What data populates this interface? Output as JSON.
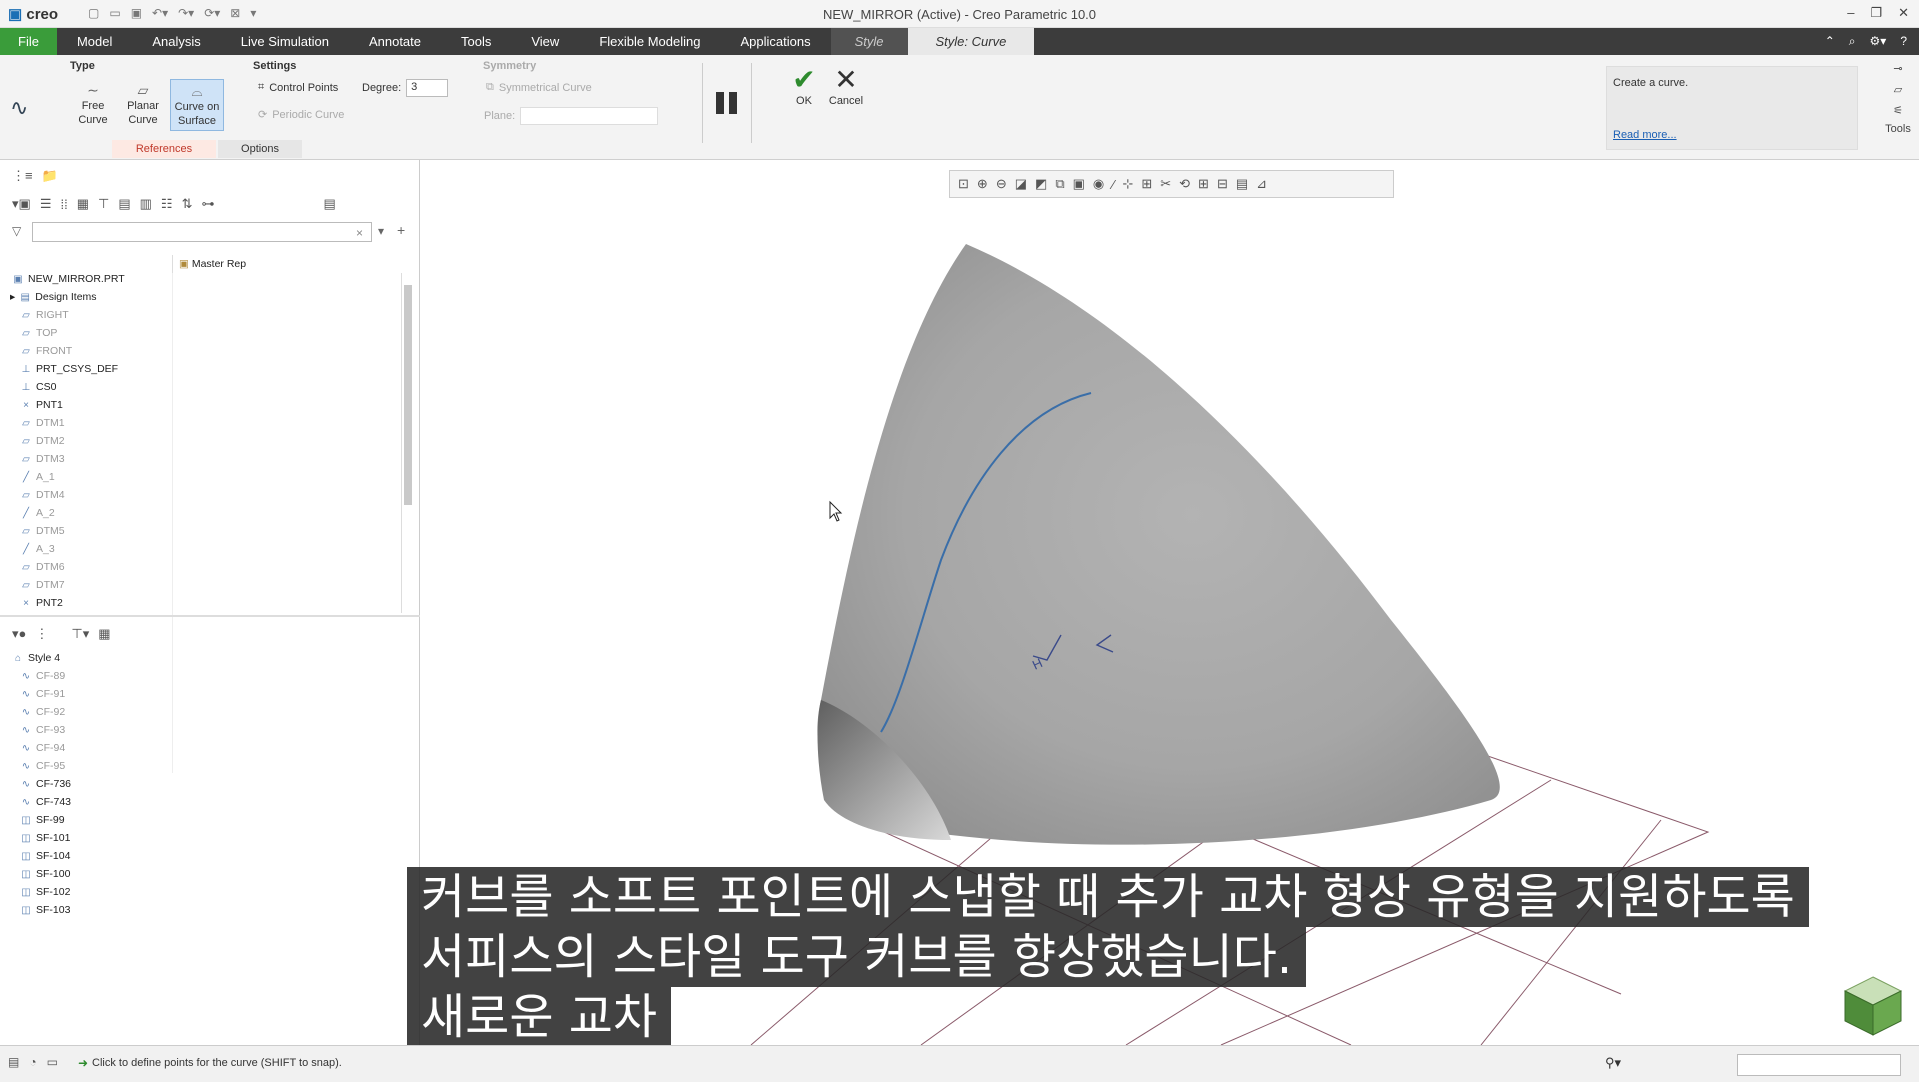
{
  "titlebar": {
    "logo": "creo",
    "title": "NEW_MIRROR (Active) - Creo Parametric 10.0",
    "window_controls": [
      "–",
      "❐",
      "✕"
    ]
  },
  "menu": {
    "file": "File",
    "items": [
      "Model",
      "Analysis",
      "Live Simulation",
      "Annotate",
      "Tools",
      "View",
      "Flexible Modeling",
      "Applications"
    ],
    "style": "Style",
    "style_curve": "Style: Curve"
  },
  "ribbon": {
    "type_label": "Type",
    "free_curve": "Free Curve",
    "planar_curve": "Planar Curve",
    "curve_on_surface": "Curve on Surface",
    "settings_label": "Settings",
    "control_points": "Control Points",
    "degree_label": "Degree:",
    "degree_value": "3",
    "periodic_curve": "Periodic Curve",
    "symmetry_label": "Symmetry",
    "symmetrical_curve": "Symmetrical Curve",
    "plane_label": "Plane:",
    "ok": "OK",
    "cancel": "Cancel",
    "tab_references": "References",
    "tab_options": "Options",
    "help_text": "Create a curve.",
    "read_more": "Read more...",
    "tools": "Tools",
    "accent_ok": "#2e8b2e",
    "accent_references": "#c0392b"
  },
  "model_tree": {
    "column_master_rep": "Master Rep",
    "items": [
      {
        "label": "NEW_MIRROR.PRT",
        "icon": "part-icon",
        "dim": false
      },
      {
        "label": "Design Items",
        "icon": "design-items-icon",
        "dim": false
      },
      {
        "label": "RIGHT",
        "icon": "datum-plane-icon",
        "dim": true
      },
      {
        "label": "TOP",
        "icon": "datum-plane-icon",
        "dim": true
      },
      {
        "label": "FRONT",
        "icon": "datum-plane-icon",
        "dim": true
      },
      {
        "label": "PRT_CSYS_DEF",
        "icon": "csys-icon",
        "dim": false
      },
      {
        "label": "CS0",
        "icon": "csys-icon",
        "dim": false
      },
      {
        "label": "PNT1",
        "icon": "datum-point-icon",
        "dim": false
      },
      {
        "label": "DTM1",
        "icon": "datum-plane-icon",
        "dim": true
      },
      {
        "label": "DTM2",
        "icon": "datum-plane-icon",
        "dim": true
      },
      {
        "label": "DTM3",
        "icon": "datum-plane-icon",
        "dim": true
      },
      {
        "label": "A_1",
        "icon": "axis-icon",
        "dim": true
      },
      {
        "label": "DTM4",
        "icon": "datum-plane-icon",
        "dim": true
      },
      {
        "label": "A_2",
        "icon": "axis-icon",
        "dim": true
      },
      {
        "label": "DTM5",
        "icon": "datum-plane-icon",
        "dim": true
      },
      {
        "label": "A_3",
        "icon": "axis-icon",
        "dim": true
      },
      {
        "label": "DTM6",
        "icon": "datum-plane-icon",
        "dim": true
      },
      {
        "label": "DTM7",
        "icon": "datum-plane-icon",
        "dim": true
      },
      {
        "label": "PNT2",
        "icon": "datum-point-icon",
        "dim": false
      }
    ]
  },
  "style_tree": {
    "items": [
      {
        "label": "Style 4",
        "icon": "style-icon",
        "dim": false
      },
      {
        "label": "CF-89",
        "icon": "curve-icon",
        "dim": true
      },
      {
        "label": "CF-91",
        "icon": "curve-icon",
        "dim": true
      },
      {
        "label": "CF-92",
        "icon": "curve-icon",
        "dim": true
      },
      {
        "label": "CF-93",
        "icon": "curve-icon",
        "dim": true
      },
      {
        "label": "CF-94",
        "icon": "curve-icon",
        "dim": true
      },
      {
        "label": "CF-95",
        "icon": "curve-icon",
        "dim": true
      },
      {
        "label": "CF-736",
        "icon": "curve-icon",
        "dim": false
      },
      {
        "label": "CF-743",
        "icon": "curve-icon",
        "dim": false
      },
      {
        "label": "SF-99",
        "icon": "surface-icon",
        "dim": false
      },
      {
        "label": "SF-101",
        "icon": "surface-icon",
        "dim": false
      },
      {
        "label": "SF-104",
        "icon": "surface-icon",
        "dim": false
      },
      {
        "label": "SF-100",
        "icon": "surface-icon",
        "dim": false
      },
      {
        "label": "SF-102",
        "icon": "surface-icon",
        "dim": false
      },
      {
        "label": "SF-103",
        "icon": "surface-icon",
        "dim": false
      }
    ]
  },
  "viewport": {
    "datum_label": "H",
    "surface_color": "#a9a9a9",
    "curve_color": "#3a6ea8",
    "grid_color": "#8a5a6a"
  },
  "subtitle": [
    "커브를 소프트 포인트에 스냅할 때 추가 교차 형상 유형을 지원하도록",
    "서피스의 스타일 도구 커브를 향상했습니다.",
    "새로운 교차"
  ],
  "statusbar": {
    "message": "Click to define points for the curve (SHIFT to snap)."
  }
}
